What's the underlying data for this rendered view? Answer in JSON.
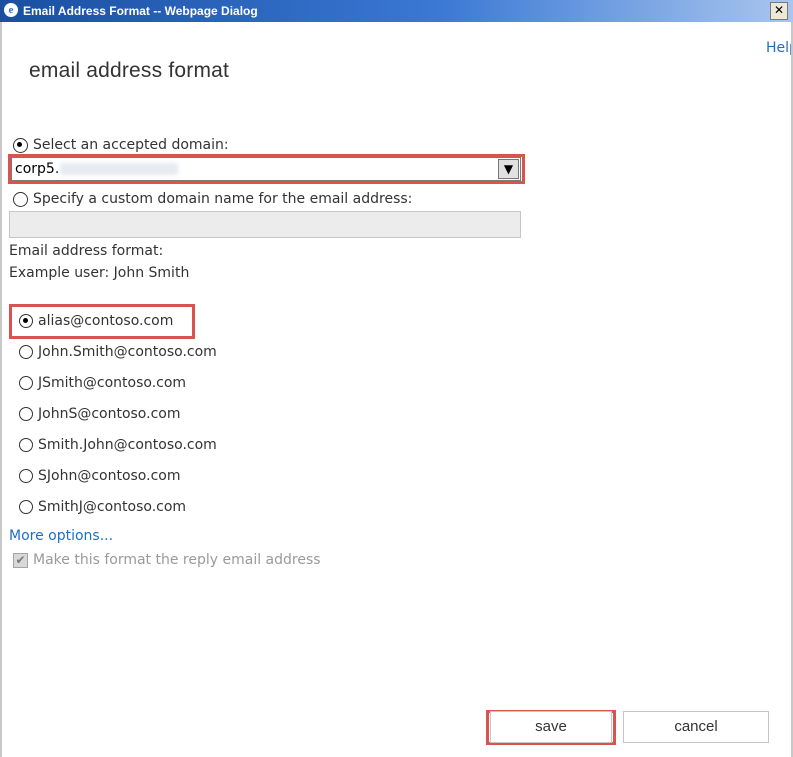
{
  "window": {
    "title": "Email Address Format -- Webpage Dialog",
    "close_glyph": "✕"
  },
  "help": {
    "label": "Help"
  },
  "page_title": "email address format",
  "domain": {
    "accepted_label": "Select an accepted domain:",
    "accepted_selected": true,
    "selected_value_visible": "corp5.",
    "selected_value_redacted": true,
    "custom_label": "Specify a custom domain name for the email address:",
    "custom_selected": false,
    "custom_value": ""
  },
  "format": {
    "heading": "Email address format:",
    "example": "Example user: John Smith",
    "options": [
      {
        "label": "alias@contoso.com",
        "selected": true
      },
      {
        "label": "John.Smith@contoso.com",
        "selected": false
      },
      {
        "label": "JSmith@contoso.com",
        "selected": false
      },
      {
        "label": "JohnS@contoso.com",
        "selected": false
      },
      {
        "label": "Smith.John@contoso.com",
        "selected": false
      },
      {
        "label": "SJohn@contoso.com",
        "selected": false
      },
      {
        "label": "SmithJ@contoso.com",
        "selected": false
      }
    ]
  },
  "more_options": "More options...",
  "reply_checkbox": {
    "label": "Make this format the reply email address",
    "checked": true,
    "disabled": true
  },
  "buttons": {
    "save": "save",
    "cancel": "cancel"
  },
  "colors": {
    "highlight": "#d9534f",
    "link": "#1e6fc4",
    "title_bar": "#3a78d4"
  },
  "icons": {
    "window_icon": "ie-icon",
    "dropdown": "chevron-down-icon",
    "close": "close-icon",
    "check": "check-icon"
  }
}
